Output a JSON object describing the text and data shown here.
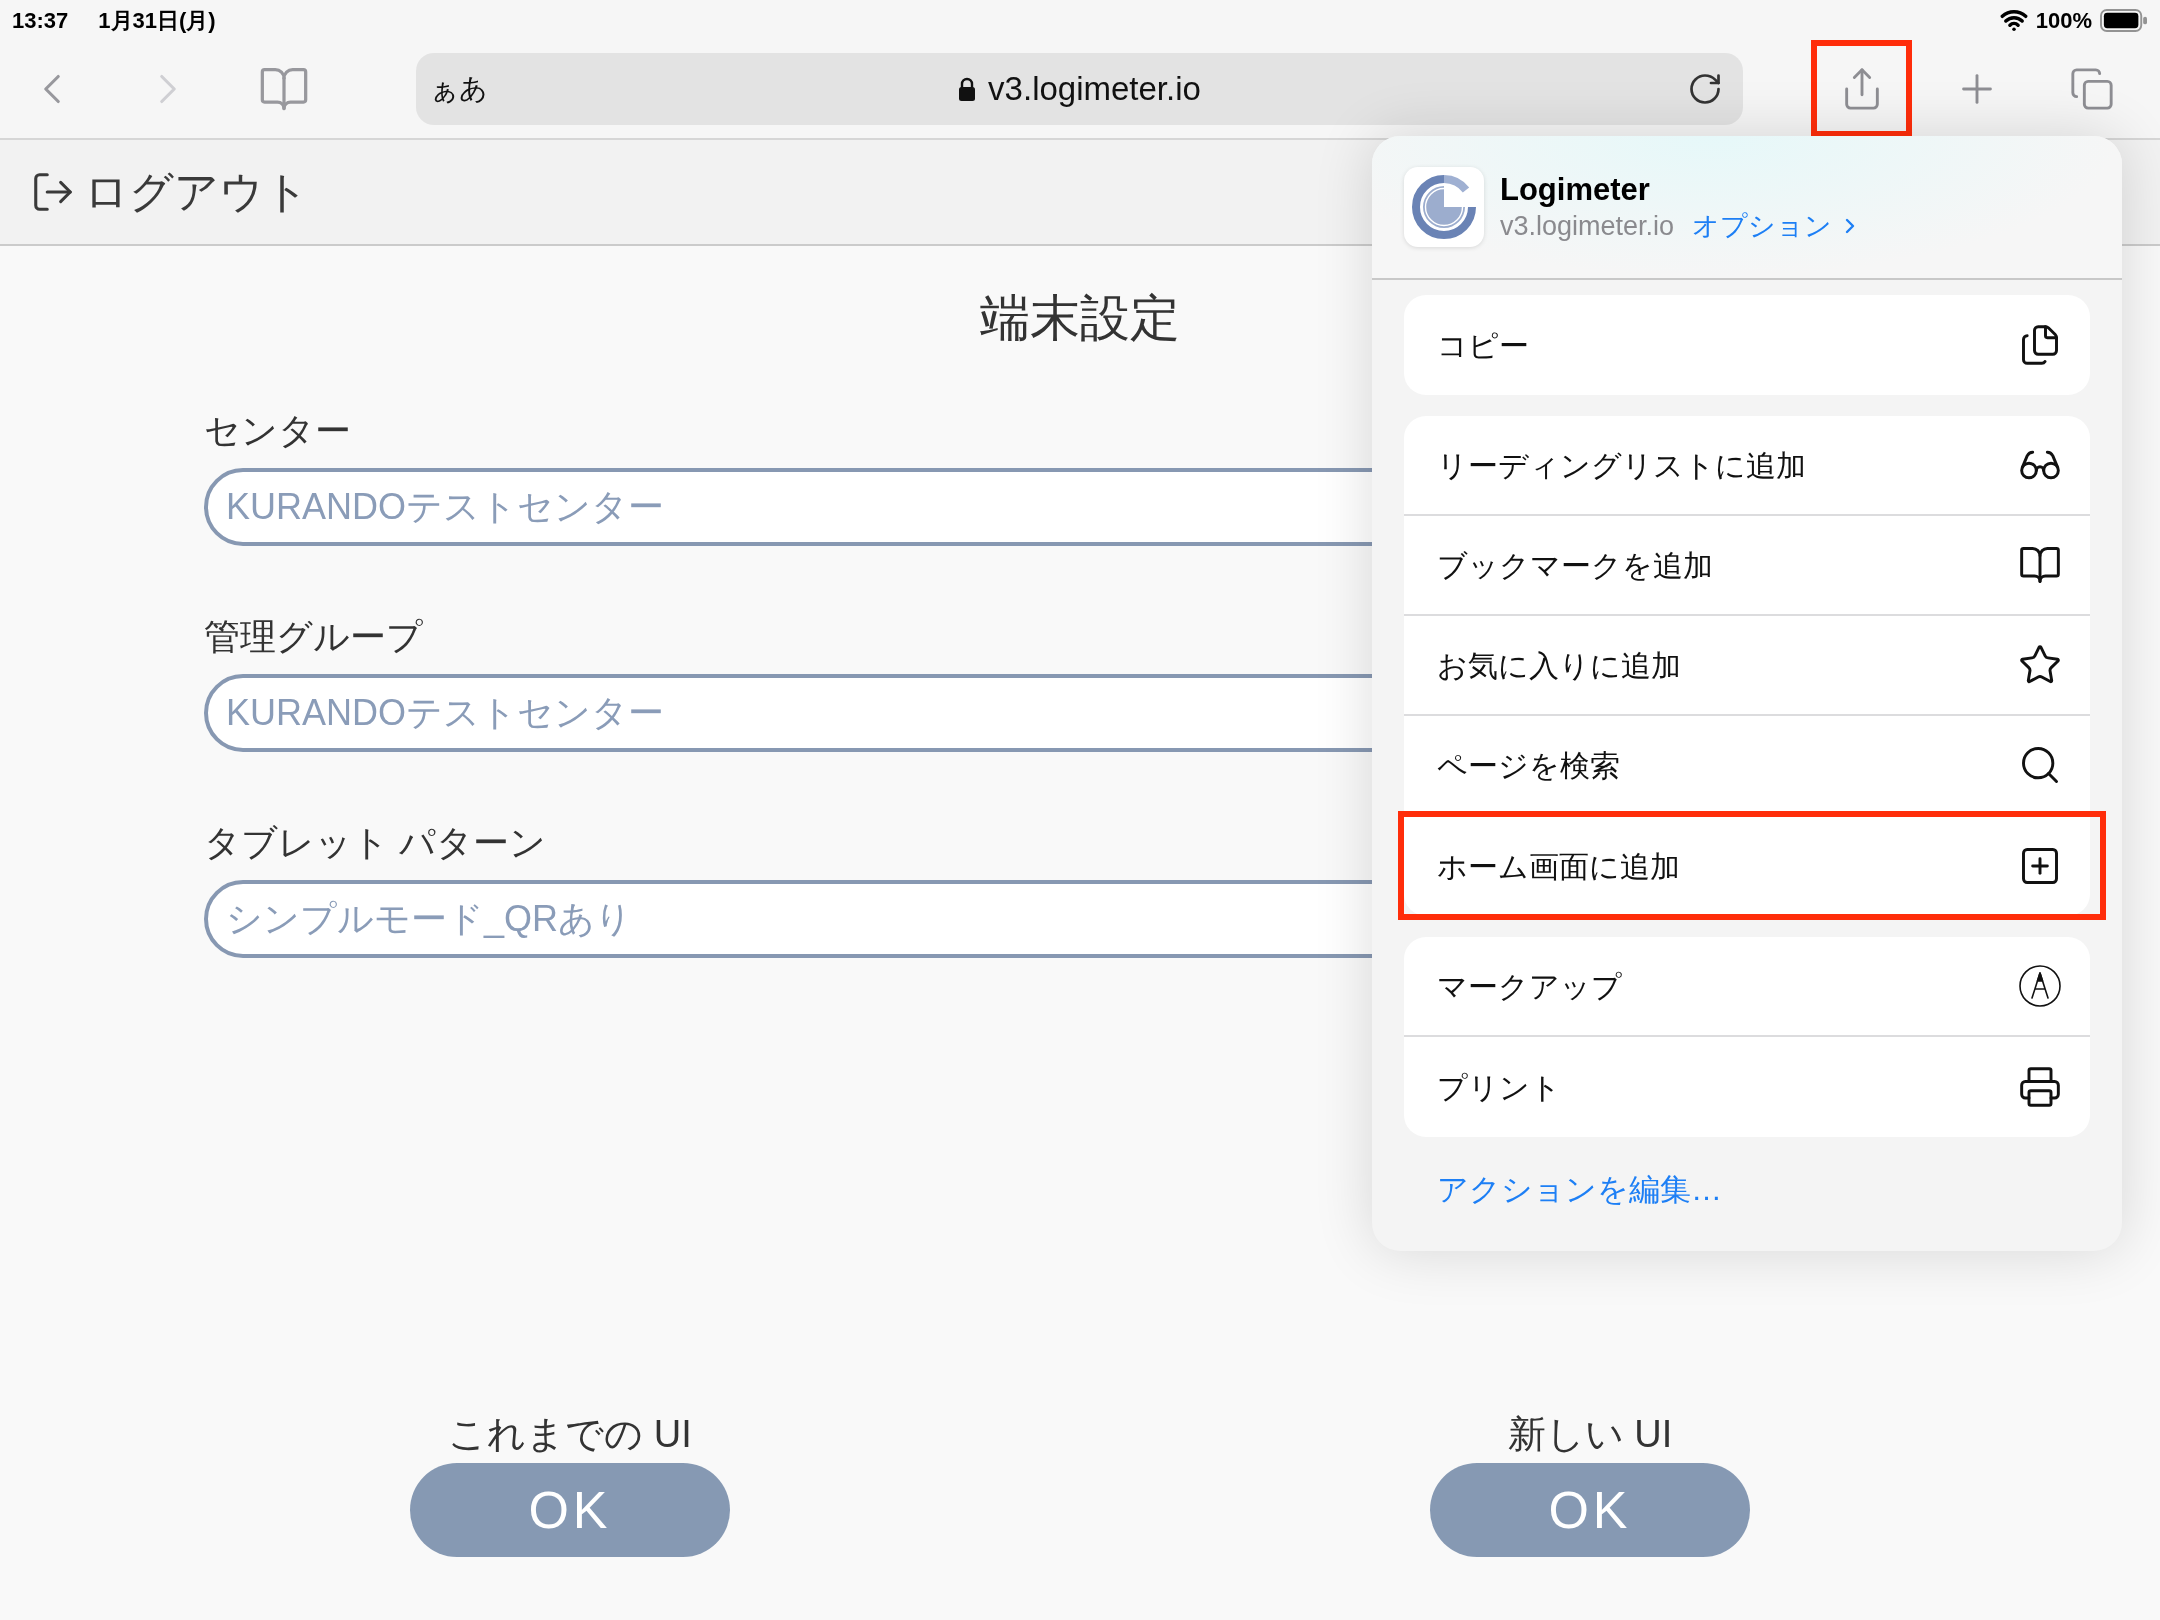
{
  "status_bar": {
    "time": "13:37",
    "date": "1月31日(月)",
    "battery": "100%"
  },
  "toolbar": {
    "nav_buttons": [
      {
        "kind": "back",
        "disabled": false
      },
      {
        "kind": "forward",
        "disabled": true
      },
      {
        "kind": "bookmarks",
        "disabled": false
      }
    ],
    "address_bar": {
      "text_size": "ぁあ",
      "url": "v3.logimeter.io"
    },
    "action_buttons": [
      {
        "kind": "share",
        "highlighted": true
      },
      {
        "kind": "new_tab",
        "highlighted": false
      },
      {
        "kind": "tabs",
        "highlighted": false
      }
    ]
  },
  "page": {
    "logout": "ログアウト",
    "title": "端末設定",
    "fields": [
      {
        "label": "センター",
        "value": "KURANDOテストセンター"
      },
      {
        "label": "管理グループ",
        "value": "KURANDOテストセンター"
      },
      {
        "label": "タブレット パターン",
        "value": "シンプルモード_QRあり"
      }
    ],
    "ui_choices": [
      {
        "caption": "これまでの UI",
        "button": "OK"
      },
      {
        "caption": "新しい UI",
        "button": "OK"
      }
    ]
  },
  "share_sheet": {
    "app": {
      "name": "Logimeter",
      "url": "v3.logimeter.io",
      "options_link": "オプション"
    },
    "groups": [
      {
        "actions": [
          {
            "label": "コピー",
            "kind": "copy",
            "highlighted": false
          }
        ]
      },
      {
        "actions": [
          {
            "label": "リーディングリストに追加",
            "kind": "reading_list",
            "highlighted": false
          },
          {
            "label": "ブックマークを追加",
            "kind": "bookmark",
            "highlighted": false
          },
          {
            "label": "お気に入りに追加",
            "kind": "favorite",
            "highlighted": false
          },
          {
            "label": "ページを検索",
            "kind": "find",
            "highlighted": false
          },
          {
            "label": "ホーム画面に追加",
            "kind": "add_home",
            "highlighted": true
          }
        ]
      },
      {
        "actions": [
          {
            "label": "マークアップ",
            "kind": "markup",
            "highlighted": false
          },
          {
            "label": "プリント",
            "kind": "print",
            "highlighted": false
          }
        ]
      }
    ],
    "edit_actions_link": "アクションを編集…"
  }
}
